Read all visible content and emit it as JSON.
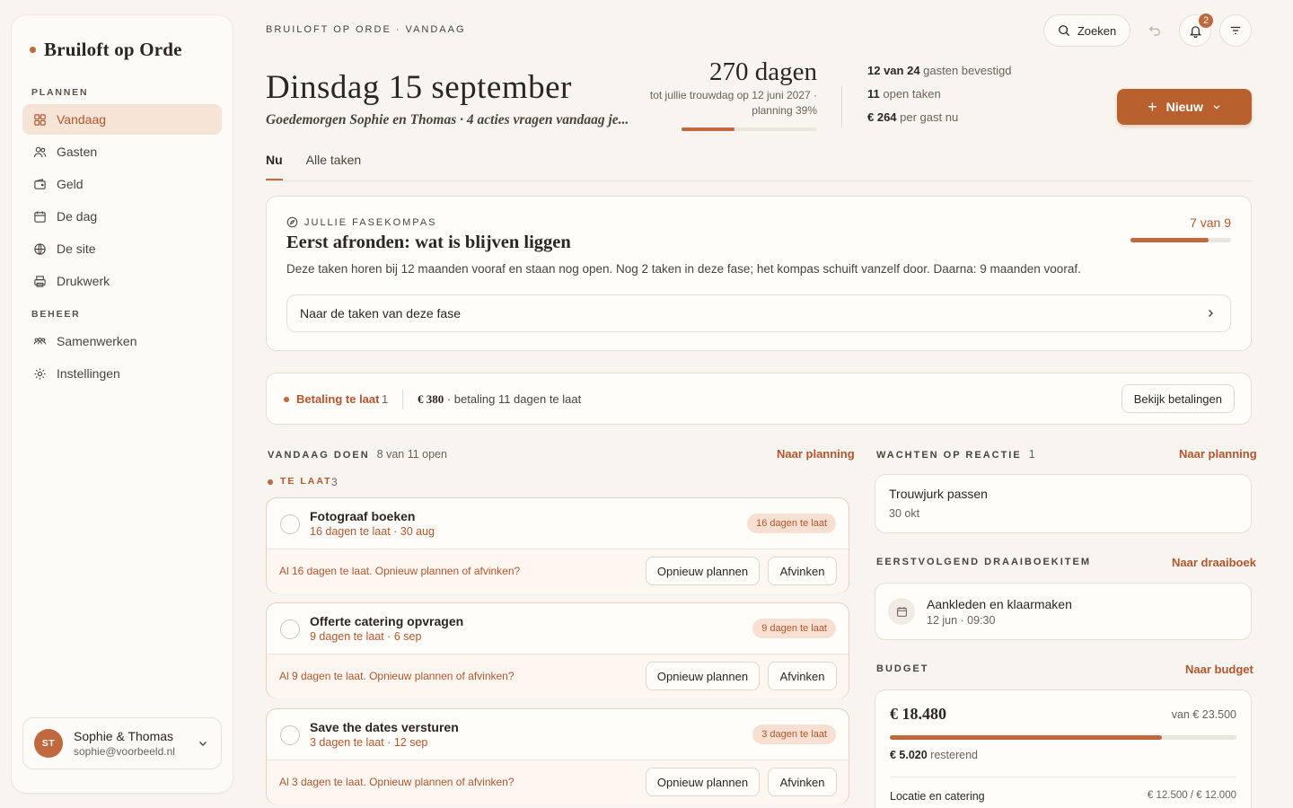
{
  "brand": {
    "name": "Bruiloft op Orde"
  },
  "sidebar": {
    "section_plan": "PLANNEN",
    "section_manage": "BEHEER",
    "items": [
      {
        "label": "Vandaag",
        "icon": "grid-icon"
      },
      {
        "label": "Gasten",
        "icon": "users-icon"
      },
      {
        "label": "Geld",
        "icon": "wallet-icon"
      },
      {
        "label": "De dag",
        "icon": "calendar-icon"
      },
      {
        "label": "De site",
        "icon": "globe-icon"
      },
      {
        "label": "Drukwerk",
        "icon": "printer-icon"
      },
      {
        "label": "Samenwerken",
        "icon": "team-icon"
      },
      {
        "label": "Instellingen",
        "icon": "gear-icon"
      }
    ],
    "user": {
      "initials": "ST",
      "name": "Sophie & Thomas",
      "email": "sophie@voorbeeld.nl"
    }
  },
  "header": {
    "breadcrumb": "BRUILOFT OP ORDE · VANDAAG",
    "title": "Dinsdag 15 september",
    "subtitle": "Goedemorgen Sophie en Thomas · 4 acties vragen vandaag je...",
    "countdown": {
      "value": "270 dagen",
      "line1": "tot jullie trouwdag op 12 juni 2027 ·",
      "line2": "planning 39%",
      "progress": 0.39
    },
    "stats": [
      {
        "strong": "12 van 24",
        "rest": " gasten bevestigd"
      },
      {
        "strong": "11",
        "rest": " open taken"
      },
      {
        "strong": "€ 264",
        "rest": " per gast nu"
      }
    ],
    "search_label": "Zoeken",
    "notifications": "2",
    "new_label": "Nieuw"
  },
  "tabs": [
    {
      "label": "Nu"
    },
    {
      "label": "Alle taken"
    }
  ],
  "kompas": {
    "label": "JULLIE FASEKOMPAS",
    "title": "Eerst afronden: wat is blijven liggen",
    "text": "Deze taken horen bij 12 maanden vooraf en staan nog open. Nog 2 taken in deze fase; het kompas schuift vanzelf door. Daarna: 9 maanden vooraf.",
    "count": "7 van 9",
    "progress": 0.78,
    "link": "Naar de taken van deze fase"
  },
  "payment": {
    "label": "Betaling te laat",
    "count": "1",
    "amount": "€ 380",
    "text": " · betaling 11 dagen te laat",
    "button": "Bekijk betalingen"
  },
  "today": {
    "title": "VANDAAG DOEN",
    "count": "8 van 11 open",
    "link": "Naar planning",
    "late_label": "TE LAAT",
    "late_count": "3",
    "tasks": [
      {
        "title": "Fotograaf boeken",
        "meta": "16 dagen te laat · 30 aug",
        "badge": "16 dagen te laat",
        "msg": "Al 16 dagen te laat. Opnieuw plannen of afvinken?",
        "plan": "Opnieuw plannen",
        "done": "Afvinken"
      },
      {
        "title": "Offerte catering opvragen",
        "meta": "9 dagen te laat · 6 sep",
        "badge": "9 dagen te laat",
        "msg": "Al 9 dagen te laat. Opnieuw plannen of afvinken?",
        "plan": "Opnieuw plannen",
        "done": "Afvinken"
      },
      {
        "title": "Save the dates versturen",
        "meta": "3 dagen te laat · 12 sep",
        "badge": "3 dagen te laat",
        "msg": "Al 3 dagen te laat. Opnieuw plannen of afvinken?",
        "plan": "Opnieuw plannen",
        "done": "Afvinken"
      }
    ]
  },
  "waiting": {
    "title": "WACHTEN OP REACTIE",
    "count": "1",
    "link": "Naar planning",
    "item_title": "Trouwjurk passen",
    "item_date": "30 okt"
  },
  "next_item": {
    "title": "EERSTVOLGEND DRAAIBOEKITEM",
    "link": "Naar draaiboek",
    "item_title": "Aankleden en klaarmaken",
    "item_time": "12 jun · 09:30"
  },
  "budget": {
    "title": "BUDGET",
    "link": "Naar budget",
    "spent": "€ 18.480",
    "total": "van € 23.500",
    "progress": 0.786,
    "remaining_strong": "€ 5.020",
    "remaining_rest": " resterend",
    "row_label": "Locatie en catering",
    "row_value": "€ 12.500 / € 12.000"
  },
  "colors": {
    "accent": "#c0683e",
    "accent_dark": "#b4562c",
    "bg": "#f8f5f0"
  }
}
